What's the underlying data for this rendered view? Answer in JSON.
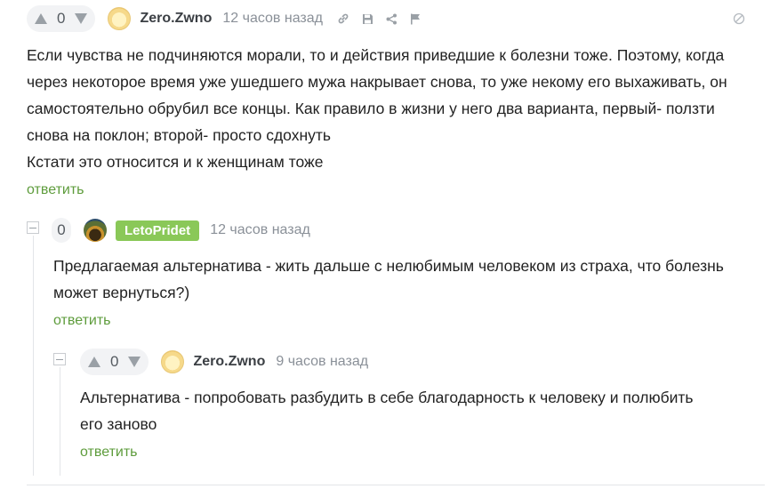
{
  "comments": [
    {
      "rating": "0",
      "author": "Zero.Zwno",
      "time": "12 часов назад",
      "text_lines": [
        "Если чувства не подчиняются морали, то и действия приведшие к болезни тоже. Поэтому, когда",
        "через некоторое время уже ушедшего мужа накрывает снова, то уже некому его выхаживать, он",
        "самостоятельно обрубил все концы. Как правило в жизни у него два варианта, первый- ползти",
        "снова на поклон; второй- просто сдохнуть",
        "Кстати это относится и к женщинам тоже"
      ],
      "reply_label": "ответить",
      "icons": [
        "link-icon",
        "save-icon",
        "share-icon",
        "flag-icon",
        "hide-icon"
      ]
    },
    {
      "rating": "0",
      "author": "LetoPridet",
      "time": "12 часов назад",
      "text_lines": [
        "Предлагаемая альтернатива - жить дальше с нелюбимым человеком из страха, что болезнь",
        "может вернуться?)"
      ],
      "reply_label": "ответить"
    },
    {
      "rating": "0",
      "author": "Zero.Zwno",
      "time": "9 часов назад",
      "text_lines": [
        "Альтернатива - попробовать разбудить в себе благодарность к человеку и полюбить",
        "его заново"
      ],
      "reply_label": "ответить"
    }
  ],
  "colors": {
    "reply_link": "#5e9c3c",
    "badge": "#8ac858",
    "timestamp": "#8a9098"
  }
}
